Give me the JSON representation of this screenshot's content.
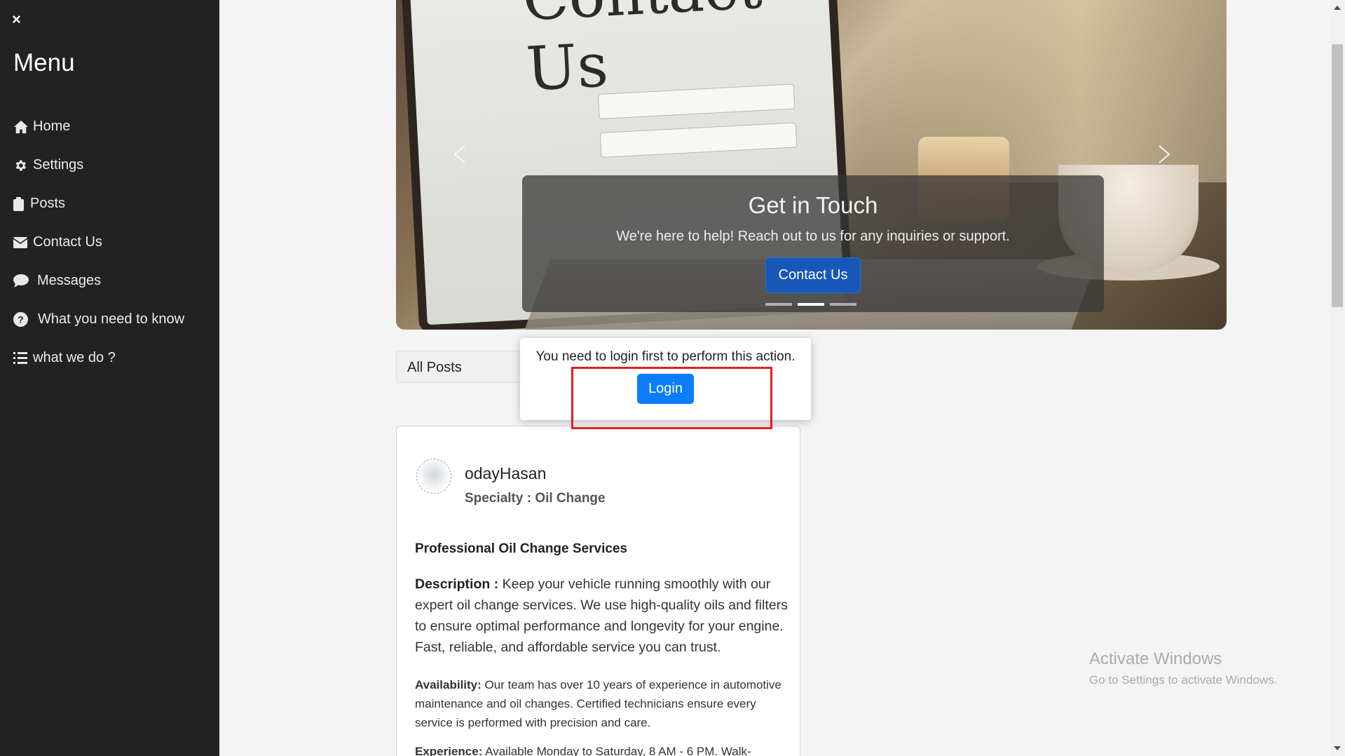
{
  "sidebar": {
    "close_label": "×",
    "title": "Menu",
    "items": [
      {
        "label": "Home",
        "icon": "home-icon"
      },
      {
        "label": "Settings",
        "icon": "gear-icon"
      },
      {
        "label": "Posts",
        "icon": "clipboard-icon"
      },
      {
        "label": "Contact Us",
        "icon": "envelope-icon"
      },
      {
        "label": "Messages",
        "icon": "chat-bubble-icon"
      },
      {
        "label": "What you need to know",
        "icon": "question-circle-icon"
      },
      {
        "label": "what we do ?",
        "icon": "list-icon"
      }
    ]
  },
  "carousel": {
    "screen_text": "Contact Us",
    "caption_title": "Get in Touch",
    "caption_text": "We're here to help! Reach out to us for any inquiries or support.",
    "cta_label": "Contact Us",
    "indicator_count": 3,
    "active_indicator": 2
  },
  "filter": {
    "selected": "All Posts"
  },
  "post": {
    "author": "odayHasan",
    "specialty": "Specialty : Oil Change",
    "title": "Professional Oil Change Services",
    "description_label": "Description :",
    "description": " Keep your vehicle running smoothly with our expert oil change services. We use high-quality oils and filters to ensure optimal performance and longevity for your engine. Fast, reliable, and affordable service you can trust.",
    "availability_label": "Availability:",
    "availability": " Our team has over 10 years of experience in automotive maintenance and oil changes. Certified technicians ensure every service is performed with precision and care.",
    "experience_label": "Experience:",
    "experience": " Available Monday to Saturday, 8 AM - 6 PM. Walk-"
  },
  "modal": {
    "message": "You need to login first to perform this action.",
    "login_label": "Login"
  },
  "watermark": {
    "line1": "Activate Windows",
    "line2": "Go to Settings to activate Windows."
  },
  "colors": {
    "sidebar_bg": "#222222",
    "primary_button": "#0b7dfa",
    "cta_button": "#1657b8",
    "highlight": "#e51d1d"
  }
}
